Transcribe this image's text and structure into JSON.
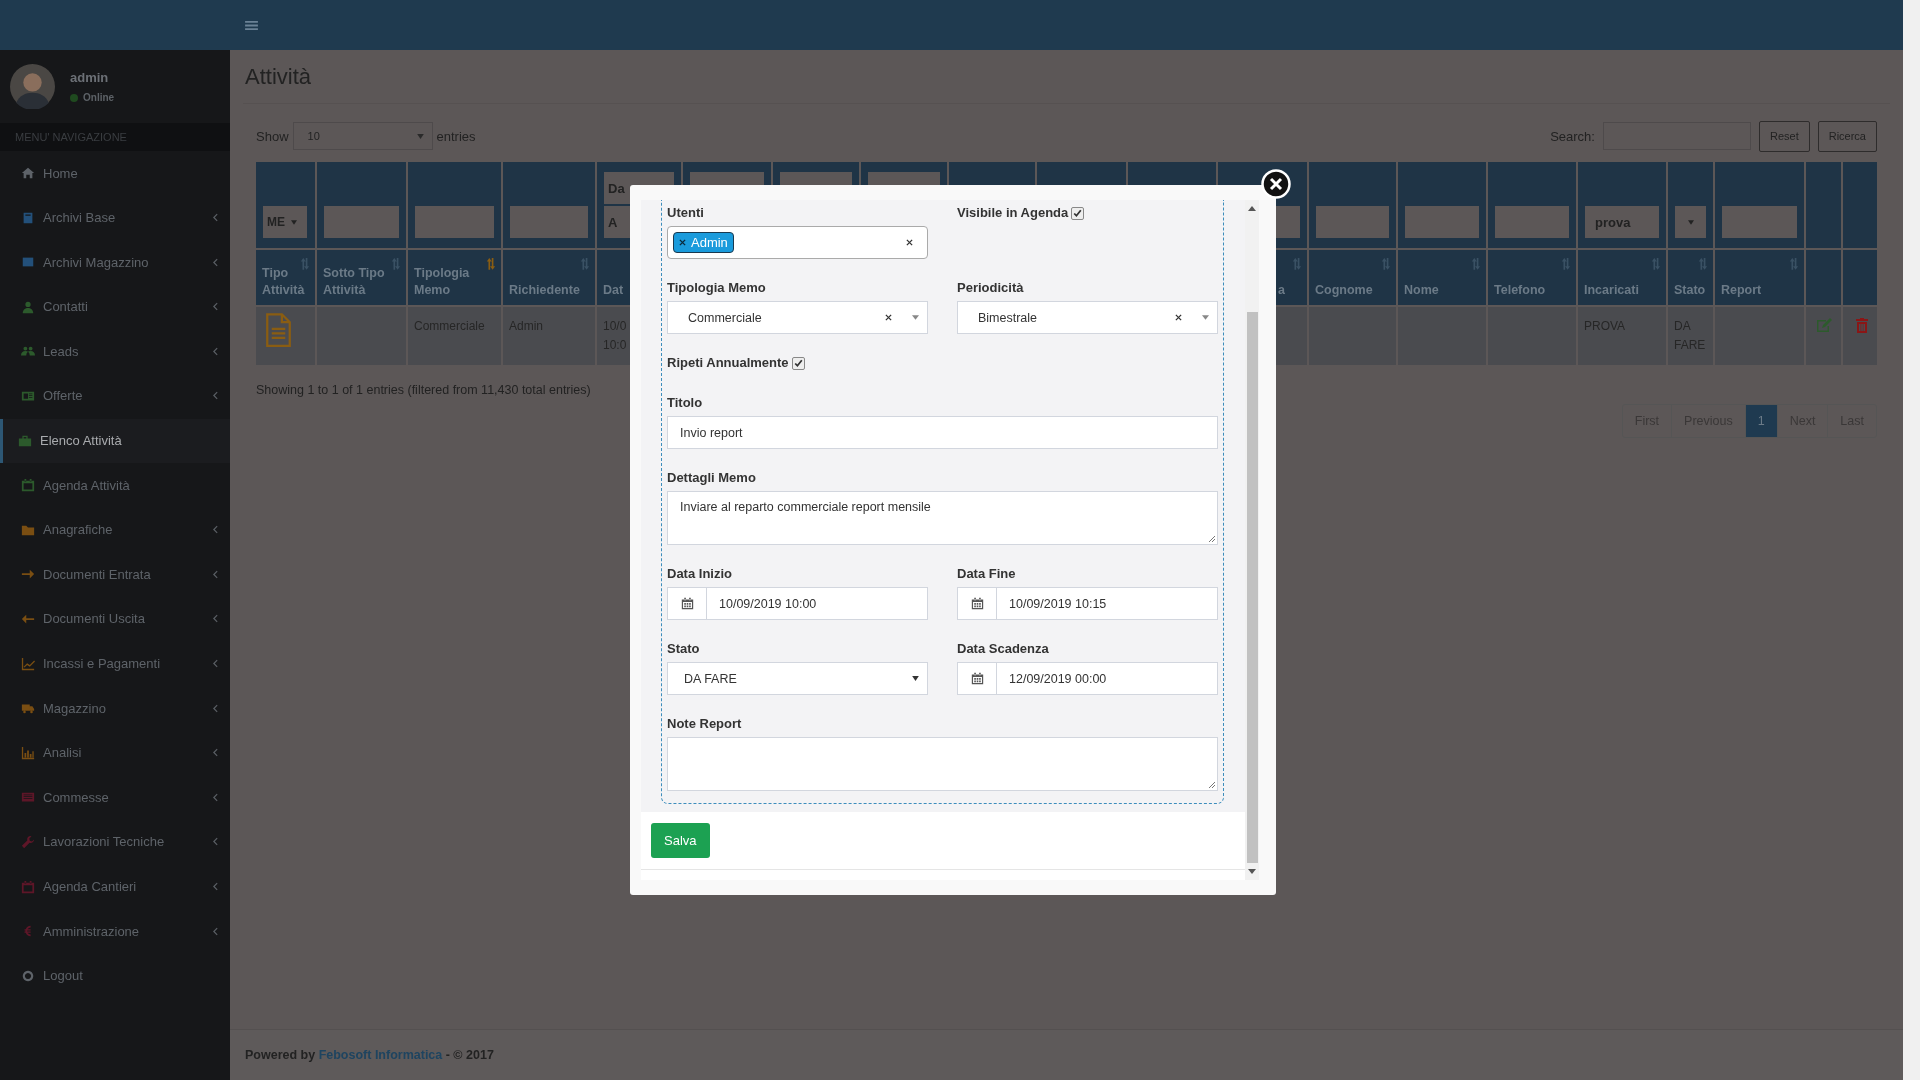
{
  "user_panel": {
    "name": "admin",
    "status": "Online"
  },
  "sidebar": {
    "header": "MENU' NAVIGAZIONE",
    "items": [
      {
        "label": "Home",
        "selected": false,
        "has_submenu": false
      },
      {
        "label": "Archivi Base",
        "selected": false,
        "has_submenu": true
      },
      {
        "label": "Archivi Magazzino",
        "selected": false,
        "has_submenu": true
      },
      {
        "label": "Contatti",
        "selected": false,
        "has_submenu": true
      },
      {
        "label": "Leads",
        "selected": false,
        "has_submenu": true
      },
      {
        "label": "Offerte",
        "selected": false,
        "has_submenu": true
      },
      {
        "label": "Elenco Attività",
        "selected": true,
        "has_submenu": false
      },
      {
        "label": "Agenda Attività",
        "selected": false,
        "has_submenu": false
      },
      {
        "label": "Anagrafiche",
        "selected": false,
        "has_submenu": true
      },
      {
        "label": "Documenti Entrata",
        "selected": false,
        "has_submenu": true
      },
      {
        "label": "Documenti Uscita",
        "selected": false,
        "has_submenu": true
      },
      {
        "label": "Incassi e Pagamenti",
        "selected": false,
        "has_submenu": true
      },
      {
        "label": "Magazzino",
        "selected": false,
        "has_submenu": true
      },
      {
        "label": "Analisi",
        "selected": false,
        "has_submenu": true
      },
      {
        "label": "Commesse",
        "selected": false,
        "has_submenu": true
      },
      {
        "label": "Lavorazioni Tecniche",
        "selected": false,
        "has_submenu": true
      },
      {
        "label": "Agenda Cantieri",
        "selected": false,
        "has_submenu": true
      },
      {
        "label": "Amministrazione",
        "selected": false,
        "has_submenu": true
      },
      {
        "label": "Logout",
        "selected": false,
        "has_submenu": false
      }
    ]
  },
  "page": {
    "title": "Attività",
    "show_label": "Show",
    "page_length": "10",
    "entries_label": "entries",
    "search_label": "Search:",
    "buttons": [
      "Reset",
      "Ricerca"
    ]
  },
  "table": {
    "columns": [
      {
        "label": "Tipo Attività",
        "sortable": true,
        "sorted": false,
        "filter": {
          "kind": "select",
          "value": "ME"
        },
        "kind": "type_icon"
      },
      {
        "label": "Sotto Tipo Attività",
        "sortable": true,
        "sorted": false,
        "filter": {
          "kind": "text"
        },
        "kind": "text"
      },
      {
        "label": "Tipologia Memo",
        "sortable": true,
        "sorted": true,
        "filter": {
          "kind": "text"
        },
        "kind": "text",
        "cell": "Commerciale"
      },
      {
        "label": "Richiedente",
        "sortable": true,
        "sorted": false,
        "filter": {
          "kind": "text"
        },
        "kind": "text",
        "cell": "Admin"
      },
      {
        "label": "Dat",
        "filter": {
          "kind": "range",
          "from_placeholder": "Da",
          "to_placeholder": "A"
        },
        "kind": "text",
        "cell": "10/0\n10:0"
      },
      {
        "filter": {
          "kind": "range"
        },
        "kind": "text"
      },
      {
        "filter": {
          "kind": "range"
        },
        "kind": "text"
      },
      {
        "filter": {
          "kind": "range"
        },
        "kind": "text"
      },
      {
        "filter": {
          "kind": "none"
        },
        "kind": "text"
      },
      {
        "filter": {
          "kind": "none"
        },
        "kind": "text"
      },
      {
        "filter": {
          "kind": "none"
        },
        "kind": "text"
      },
      {
        "label": "a",
        "sortable": true,
        "sorted": false,
        "filter": {
          "kind": "text"
        },
        "kind": "text"
      },
      {
        "label": "Cognome",
        "sortable": true,
        "sorted": false,
        "filter": {
          "kind": "text"
        },
        "kind": "text"
      },
      {
        "label": "Nome",
        "sortable": true,
        "sorted": false,
        "filter": {
          "kind": "text"
        },
        "kind": "text"
      },
      {
        "label": "Telefono",
        "sortable": true,
        "sorted": false,
        "filter": {
          "kind": "text"
        },
        "kind": "text"
      },
      {
        "label": "Incaricati",
        "sortable": true,
        "sorted": false,
        "filter": {
          "kind": "text",
          "value": "prova"
        },
        "kind": "text",
        "cell": "PROVA"
      },
      {
        "label": "Stato",
        "sortable": true,
        "sorted": false,
        "filter": {
          "kind": "select"
        },
        "kind": "text",
        "cell": "DA FARE"
      },
      {
        "label": "Report",
        "sortable": true,
        "sorted": false,
        "filter": {
          "kind": "text"
        },
        "kind": "text"
      },
      {
        "filter": {
          "kind": "none"
        },
        "kind": "edit"
      },
      {
        "filter": {
          "kind": "none"
        },
        "kind": "delete"
      }
    ]
  },
  "info": "Showing 1 to 1 of 1 entries (filtered from 11,430 total entries)",
  "pagination": [
    {
      "label": "First",
      "selected": false
    },
    {
      "label": "Previous",
      "selected": false
    },
    {
      "label": "1",
      "selected": true
    },
    {
      "label": "Next",
      "selected": false
    },
    {
      "label": "Last",
      "selected": false
    }
  ],
  "footer": {
    "prefix": "Powered by",
    "link": "Febosoft Informatica",
    "suffix": "- © 2017"
  },
  "modal": {
    "utenti": {
      "label": "Utenti",
      "tags": [
        "Admin"
      ]
    },
    "visibile": {
      "label": "Visibile in Agenda",
      "checked": true
    },
    "tipologia": {
      "label": "Tipologia Memo",
      "value": "Commerciale"
    },
    "periodicita": {
      "label": "Periodicità",
      "value": "Bimestrale"
    },
    "ripeti": {
      "label": "Ripeti Annualmente",
      "checked": true
    },
    "titolo": {
      "label": "Titolo",
      "value": "Invio report"
    },
    "dettagli": {
      "label": "Dettagli Memo",
      "value": "Inviare al reparto commerciale report mensile"
    },
    "data_inizio": {
      "label": "Data Inizio",
      "value": "10/09/2019 10:00"
    },
    "data_fine": {
      "label": "Data Fine",
      "value": "10/09/2019 10:15"
    },
    "stato": {
      "label": "Stato",
      "value": "DA FARE"
    },
    "data_scadenza": {
      "label": "Data Scadenza",
      "value": "12/09/2019 00:00"
    },
    "note_report": {
      "label": "Note Report"
    },
    "save_button": "Salva"
  }
}
